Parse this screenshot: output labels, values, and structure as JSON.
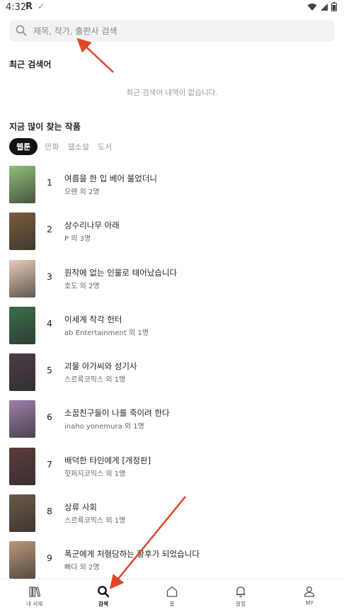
{
  "status_bar": {
    "time": "4:32",
    "r_glyph": "R",
    "check_glyph": "✓",
    "icons": [
      "wifi-icon",
      "signal-icon",
      "battery-icon"
    ]
  },
  "search": {
    "placeholder": "제목, 작가, 출판사 검색",
    "value": ""
  },
  "recent": {
    "title": "최근 검색어",
    "empty_text": "최근 검색어 내역이 없습니다."
  },
  "popular": {
    "title": "지금 많이 찾는 작품",
    "tabs": [
      "웹툰",
      "만화",
      "웹소설",
      "도서"
    ],
    "active_tab": 0,
    "items": [
      {
        "rank": "1",
        "title": "여름을 한 입 베어 물었더니",
        "author": "오렌 외 2명",
        "thumb_color": "#8fbf7a"
      },
      {
        "rank": "2",
        "title": "상수리나무 아래",
        "author": "P 외 3명",
        "thumb_color": "#7a5b3c"
      },
      {
        "rank": "3",
        "title": "원작에 없는 인물로 태어났습니다",
        "author": "호도 외 2명",
        "thumb_color": "#e8c9b8"
      },
      {
        "rank": "4",
        "title": "이세계 착각 헌터",
        "author": "ab Entertainment 외 1명",
        "thumb_color": "#3a6e4a"
      },
      {
        "rank": "5",
        "title": "괴물 아가씨와 성기사",
        "author": "스르륵코믹스 외 1명",
        "thumb_color": "#4a3c48"
      },
      {
        "rank": "6",
        "title": "소꿉친구들이 나를 죽이려 한다",
        "author": "inaho yonemura 외 1명",
        "thumb_color": "#9c7fa8"
      },
      {
        "rank": "7",
        "title": "배덕한 타인에게 [개정판]",
        "author": "핫퍼지코믹스 외 1명",
        "thumb_color": "#5c3b3b"
      },
      {
        "rank": "8",
        "title": "상류 사회",
        "author": "스르륵코믹스 외 1명",
        "thumb_color": "#6b5a45"
      },
      {
        "rank": "9",
        "title": "폭군에게 처형당하는 황후가 되었습니다",
        "author": "빠다 외 2명",
        "thumb_color": "#b89878"
      }
    ]
  },
  "bottom_nav": {
    "items": [
      {
        "label": "내 서재",
        "icon": "library-icon"
      },
      {
        "label": "검색",
        "icon": "search-icon"
      },
      {
        "label": "홈",
        "icon": "home-icon"
      },
      {
        "label": "알림",
        "icon": "bell-icon"
      },
      {
        "label": "MY",
        "icon": "user-icon"
      }
    ],
    "active": 1
  },
  "colors": {
    "active_tab_bg": "#111111",
    "annotation_arrow": "#e0452a"
  }
}
